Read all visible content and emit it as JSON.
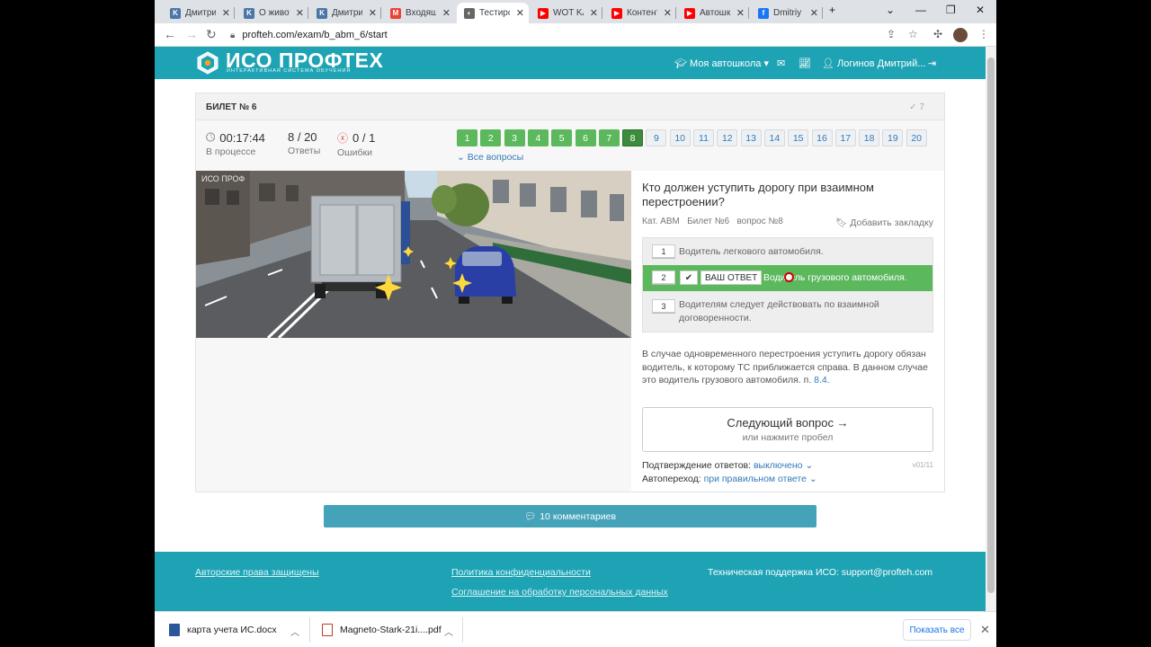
{
  "browser": {
    "tabs": [
      {
        "title": "Дмитрий",
        "icon": "vk-icon",
        "color": "#4a76a8",
        "glyph": "K"
      },
      {
        "title": "О живот",
        "icon": "vk-icon",
        "color": "#4a76a8",
        "glyph": "K"
      },
      {
        "title": "Дмитрий",
        "icon": "vk-icon",
        "color": "#4a76a8",
        "glyph": "K"
      },
      {
        "title": "Входящ",
        "icon": "gmail-icon",
        "color": "#ea4335",
        "glyph": "M"
      },
      {
        "title": "Тестиро",
        "icon": "profteh-icon",
        "color": "#666666",
        "glyph": "◐"
      },
      {
        "title": "WOT KA",
        "icon": "youtube-icon",
        "color": "#ff0000",
        "glyph": "▶"
      },
      {
        "title": "Контент",
        "icon": "youtube-icon",
        "color": "#ff0000",
        "glyph": "▶"
      },
      {
        "title": "Автошк",
        "icon": "youtube-icon",
        "color": "#ff0000",
        "glyph": "▶"
      },
      {
        "title": "Dmitriy",
        "icon": "facebook-icon",
        "color": "#1877f2",
        "glyph": "f"
      }
    ],
    "url": "profteh.com/exam/b_abm_6/start"
  },
  "header": {
    "logo_title": "ИСО ПРОФТЕХ",
    "logo_subtitle": "ИНТЕРАКТИВНАЯ СИСТЕМА ОБУЧЕНИЯ",
    "school_menu": "Моя автошкола",
    "user_name": "Логинов Дмитрий..."
  },
  "exam": {
    "ticket_title": "БИЛЕТ № 6",
    "check_count": "7",
    "timer": "00:17:44",
    "timer_label": "В процессе",
    "answers_value": "8 / 20",
    "answers_label": "Ответы",
    "errors_value": "0 / 1",
    "errors_label": "Ошибки",
    "question_numbers": [
      "1",
      "2",
      "3",
      "4",
      "5",
      "6",
      "7",
      "8",
      "9",
      "10",
      "11",
      "12",
      "13",
      "14",
      "15",
      "16",
      "17",
      "18",
      "19",
      "20"
    ],
    "answered_count": 7,
    "current_question": 8,
    "all_questions_label": "Все вопросы",
    "image_watermark": "ИСО ПРОФ",
    "question_text": "Кто должен уступить дорогу при взаимном перестроении?",
    "meta": {
      "category": "Кат. АВМ",
      "ticket": "Билет №6",
      "question": "вопрос №8"
    },
    "bookmark_label": "Добавить закладку",
    "answers": [
      {
        "num": "1",
        "text": "Водитель легкового автомобиля."
      },
      {
        "num": "2",
        "text": "Водитель грузового автомобиля."
      },
      {
        "num": "3",
        "text": "Водителям следует действовать по взаимной договоренности."
      }
    ],
    "your_answer_label": "ВАШ ОТВЕТ",
    "explanation": "В случае одновременного перестроения уступить дорогу обязан водитель, к которому ТС приближается справа. В данном случае это водитель грузового автомобиля. п.",
    "explanation_link": "8.4.",
    "next_button": "Следующий вопрос →",
    "next_hint": "или нажмите пробел",
    "confirm_label": "Подтверждение ответов:",
    "confirm_value": "выключено",
    "autoadvance_label": "Автопереход:",
    "autoadvance_value": "при правильном ответе",
    "version": "v01/11"
  },
  "comments_button": "10 комментариев",
  "footer": {
    "copyright": "Авторские права защищены",
    "privacy": "Политика конфиденциальности",
    "personal_data": "Соглашение на обработку персональных данных",
    "support": "Техническая поддержка ИСО:  support@profteh.com"
  },
  "downloads": [
    {
      "name": "карта учета ИС.docx",
      "icon": "word-file-icon"
    },
    {
      "name": "Magneto-Stark-21i....pdf",
      "icon": "pdf-file-icon"
    }
  ],
  "downloads_show_all": "Показать все",
  "colors": {
    "brand": "#1ea3b4",
    "correct": "#5cb85c",
    "current": "#3d8b3d",
    "link": "#337ab7"
  }
}
